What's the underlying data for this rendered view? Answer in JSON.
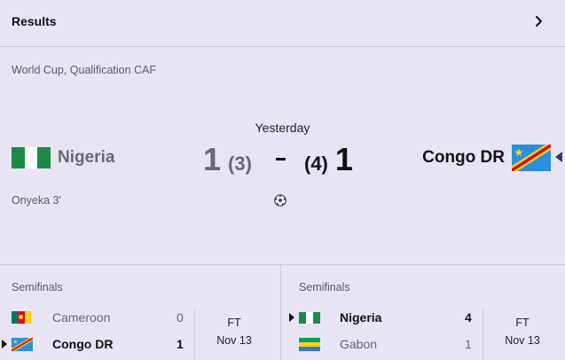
{
  "header": {
    "title": "Results"
  },
  "match": {
    "competition": "World Cup, Qualification CAF",
    "when": "Yesterday",
    "home": {
      "name": "Nigeria",
      "score": "1",
      "penalties": "(3)",
      "flag": "flag-nigeria-icon"
    },
    "away": {
      "name": "Congo DR",
      "score": "1",
      "penalties": "(4)",
      "flag": "flag-congo-dr-icon"
    },
    "scorer": "Onyeka 3'",
    "event_icon": "football-icon"
  },
  "semifinals": [
    {
      "stage": "Semifinals",
      "teams": [
        {
          "name": "Cameroon",
          "score": "0",
          "winner": false,
          "flag": "flag-cameroon-icon"
        },
        {
          "name": "Congo DR",
          "score": "1",
          "winner": true,
          "flag": "flag-congo-dr-icon"
        }
      ],
      "status": "FT",
      "date": "Nov 13"
    },
    {
      "stage": "Semifinals",
      "teams": [
        {
          "name": "Nigeria",
          "score": "4",
          "winner": true,
          "flag": "flag-nigeria-icon"
        },
        {
          "name": "Gabon",
          "score": "1",
          "winner": false,
          "flag": "flag-gabon-icon"
        }
      ],
      "status": "FT",
      "date": "Nov 13"
    }
  ],
  "colors": {
    "background": "#e8e4f3",
    "divider": "#cfcbdc",
    "muted_text": "#6b6872",
    "nigeria_green": "#1e8b45",
    "congo_blue": "#2a8fdc",
    "congo_red": "#ce1021",
    "congo_yellow": "#f7d618",
    "cameroon_green": "#007a5e",
    "cameroon_red": "#ce1126",
    "cameroon_yellow": "#fcd116",
    "gabon_green": "#009e60",
    "gabon_yellow": "#fcd116",
    "gabon_blue": "#3a75c4"
  }
}
